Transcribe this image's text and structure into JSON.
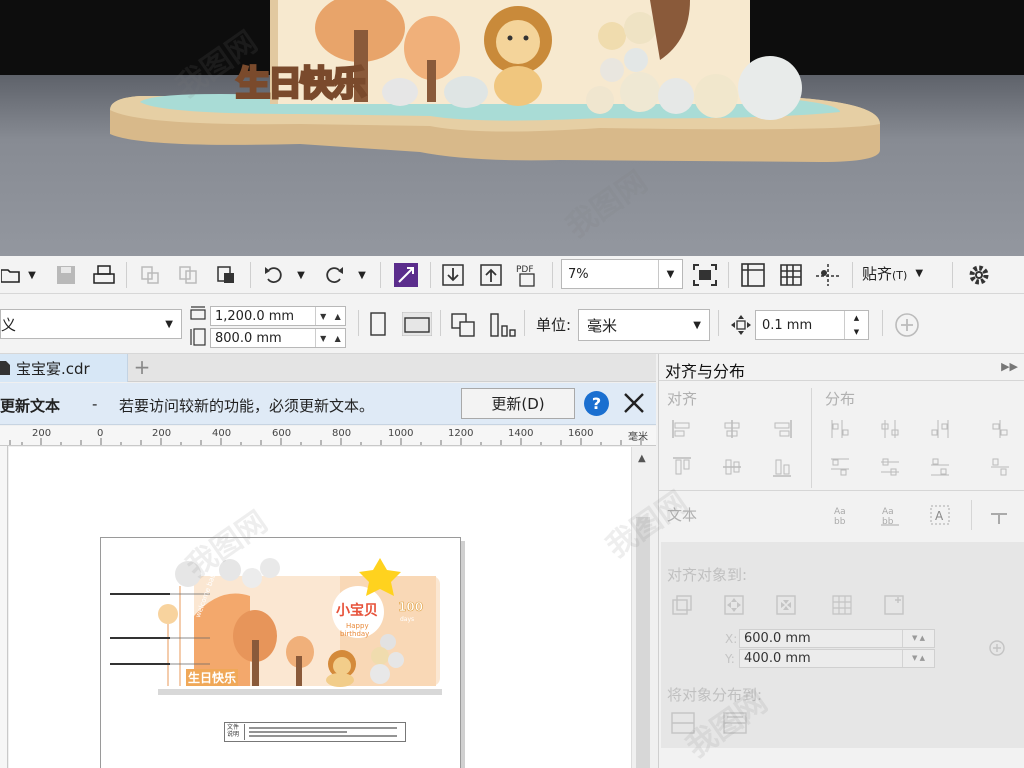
{
  "render_preview": {
    "banner_text": "生日快乐"
  },
  "toolbar": {
    "zoom_value": "7%",
    "snap_label": "贴齐",
    "snap_accel": "(T)"
  },
  "property_bar": {
    "preset_value": "义",
    "width_value": "1,200.0 mm",
    "height_value": "800.0 mm",
    "unit_label": "单位:",
    "unit_value": "毫米",
    "nudge_value": "0.1 mm"
  },
  "document": {
    "tab_name": "宝宝宴.cdr",
    "new_tab_symbol": "+"
  },
  "notification": {
    "title": "更新文本",
    "separator": "-",
    "message": "若要访问较新的功能，必须更新文本。",
    "update_button": "更新(D)",
    "help_symbol": "?"
  },
  "ruler": {
    "labels": [
      "200",
      "0",
      "200",
      "400",
      "600",
      "800",
      "1000",
      "1200",
      "1400",
      "1600"
    ],
    "unit": "毫米"
  },
  "artwork": {
    "badge_title": "小宝贝",
    "badge_line1": "Happy",
    "badge_line2": "birthday",
    "days_number": "100",
    "days_word": "days",
    "welcome_text": "welcome baby",
    "banner_text": "生日快乐",
    "file_label": "文件说明"
  },
  "docker": {
    "title": "对齐与分布",
    "align_label": "对齐",
    "distribute_label": "分布",
    "text_label": "文本",
    "align_to_label": "对齐对象到:",
    "x_axis": "X:",
    "y_axis": "Y:",
    "x_value": "600.0 mm",
    "y_value": "400.0 mm",
    "distribute_to_label": "将对象分布到:"
  },
  "colors": {
    "accent_blue": "#1a6fd0",
    "notice_bg": "#dfeaf6",
    "purple_icon": "#5b2d8c"
  }
}
